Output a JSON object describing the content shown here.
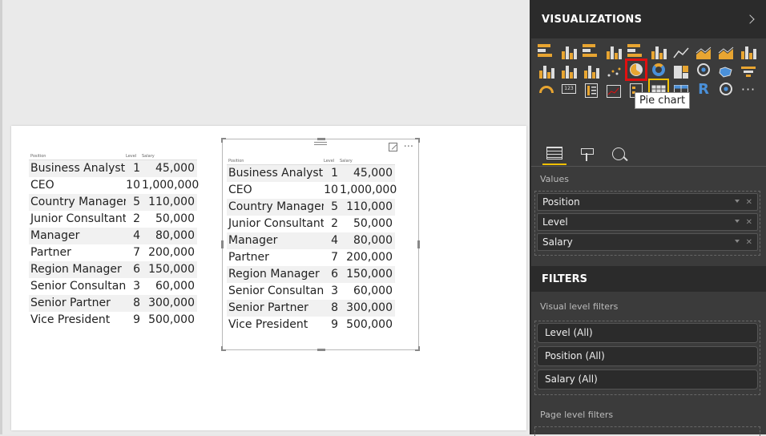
{
  "table": {
    "headers": [
      "Position",
      "Level",
      "Salary"
    ],
    "rows": [
      [
        "Business Analyst",
        "1",
        "45,000"
      ],
      [
        "CEO",
        "10",
        "1,000,000"
      ],
      [
        "Country Manager",
        "5",
        "110,000"
      ],
      [
        "Junior Consultant",
        "2",
        "50,000"
      ],
      [
        "Manager",
        "4",
        "80,000"
      ],
      [
        "Partner",
        "7",
        "200,000"
      ],
      [
        "Region Manager",
        "6",
        "150,000"
      ],
      [
        "Senior Consultant",
        "3",
        "60,000"
      ],
      [
        "Senior Partner",
        "8",
        "300,000"
      ],
      [
        "Vice President",
        "9",
        "500,000"
      ]
    ]
  },
  "visual_header": {
    "more_label": "···"
  },
  "visualizations": {
    "title": "VISUALIZATIONS",
    "tooltip": "Pie chart",
    "more_label": "···",
    "r_label": "R",
    "card_label": "123"
  },
  "fields": {
    "values_label": "Values",
    "items": [
      "Position",
      "Level",
      "Salary"
    ],
    "remove_glyph": "✕"
  },
  "filters": {
    "title": "FILTERS",
    "visual_level_label": "Visual level filters",
    "visual_level_items": [
      "Level (All)",
      "Position (All)",
      "Salary (All)"
    ],
    "page_level_label": "Page level filters"
  },
  "colors": {
    "accent": "#f0c000",
    "highlight": "#e01010",
    "pane_bg": "#3b3b3b",
    "header_bg": "#2b2b2b",
    "bar_orange": "#e8a531"
  }
}
